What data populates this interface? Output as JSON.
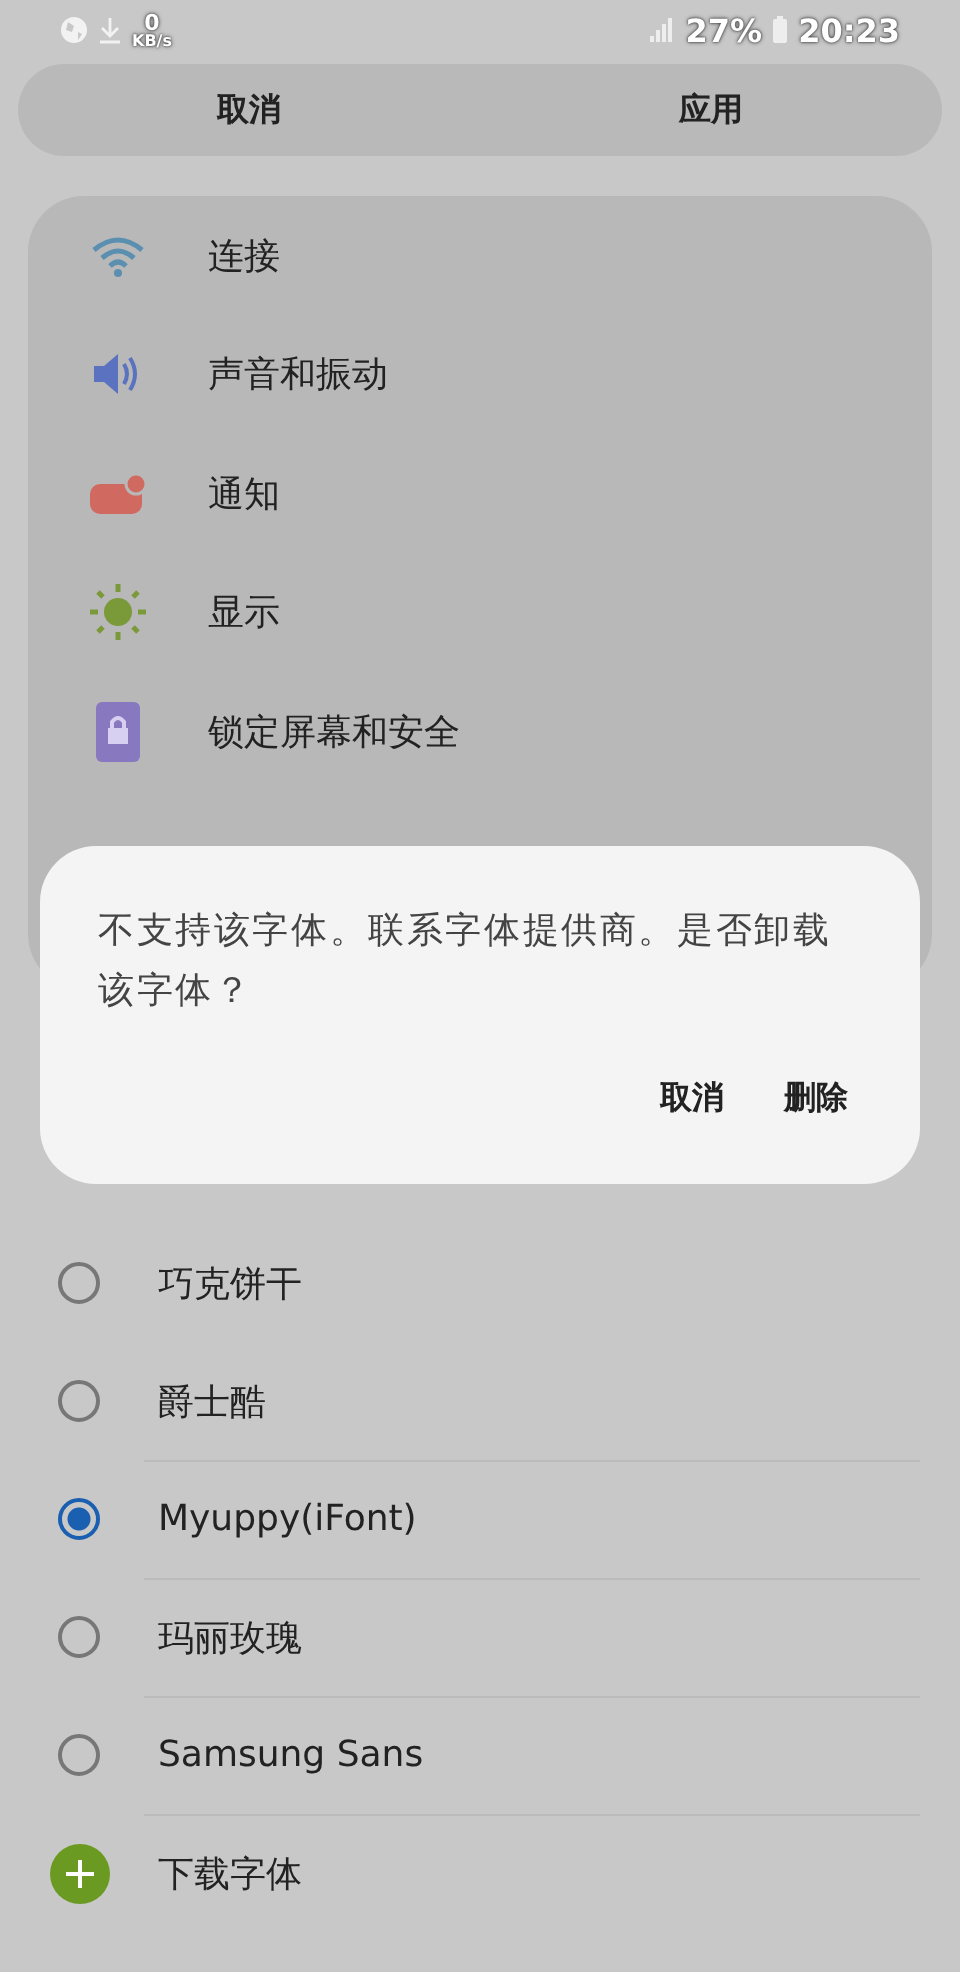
{
  "status_bar": {
    "speed_value": "0",
    "speed_unit": "KB/s",
    "battery": "27%",
    "time": "20:23"
  },
  "top_bar": {
    "buttons": [
      "取消",
      "应用"
    ]
  },
  "settings_preview": {
    "items": [
      {
        "kind": "wifi",
        "label": "连接"
      },
      {
        "kind": "sound",
        "label": "声音和振动"
      },
      {
        "kind": "notification",
        "label": "通知"
      },
      {
        "kind": "display",
        "label": "显示"
      },
      {
        "kind": "lock",
        "label": "锁定屏幕和安全"
      }
    ]
  },
  "fonts": [
    {
      "kind": "font",
      "label": "巧克饼干",
      "selected": false
    },
    {
      "kind": "font",
      "label": "爵士酷",
      "selected": false
    },
    {
      "kind": "font",
      "label": "Myuppy(iFont)",
      "selected": true
    },
    {
      "kind": "font",
      "label": "玛丽玫瑰",
      "selected": false
    },
    {
      "kind": "font",
      "label": "Samsung Sans",
      "selected": false
    },
    {
      "kind": "download",
      "label": "下载字体"
    }
  ],
  "dialog": {
    "message": "不支持该字体。联系字体提供商。是否卸载该字体？",
    "buttons": [
      "取消",
      "删除"
    ]
  }
}
